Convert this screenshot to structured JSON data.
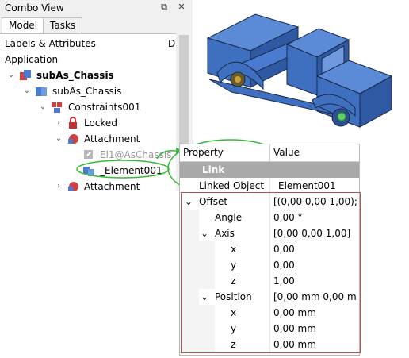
{
  "combo": {
    "title": "Combo View",
    "tabs": [
      "Model",
      "Tasks"
    ],
    "section_header": "Labels & Attributes",
    "section_header_right": "D",
    "tree": [
      {
        "label": "Application",
        "indent": 0
      },
      {
        "label": "subAs_Chassis",
        "bold": true
      },
      {
        "label": "subAs_Chassis"
      },
      {
        "label": "Constraints001"
      },
      {
        "label": "Locked"
      },
      {
        "label": "Attachment"
      },
      {
        "label": "El1@AsChassis"
      },
      {
        "label": "_Element001"
      },
      {
        "label": "Attachment"
      }
    ]
  },
  "properties": {
    "header_property": "Property",
    "header_value": "Value",
    "group_link": "Link",
    "rows": [
      {
        "name": "Linked Object",
        "value": "_Element001"
      },
      {
        "name": "Offset",
        "value": "[(0,00 0,00 1,00); 0..."
      },
      {
        "name": "Angle",
        "value": "0,00 °"
      },
      {
        "name": "Axis",
        "value": "[0,00 0,00 1,00]"
      },
      {
        "name": "x",
        "value": "0,00"
      },
      {
        "name": "y",
        "value": "0,00"
      },
      {
        "name": "z",
        "value": "1,00"
      },
      {
        "name": "Position",
        "value": "[0,00 mm  0,00 m..."
      },
      {
        "name": "x",
        "value": "0,00 mm"
      },
      {
        "name": "y",
        "value": "0,00 mm"
      },
      {
        "name": "z",
        "value": "0,00 mm"
      }
    ]
  },
  "colors": {
    "model_blue": "#3f6fbf",
    "annotation_green": "#33bb33",
    "highlight_red": "#c0504d",
    "group_grey": "#a9a9a9"
  }
}
